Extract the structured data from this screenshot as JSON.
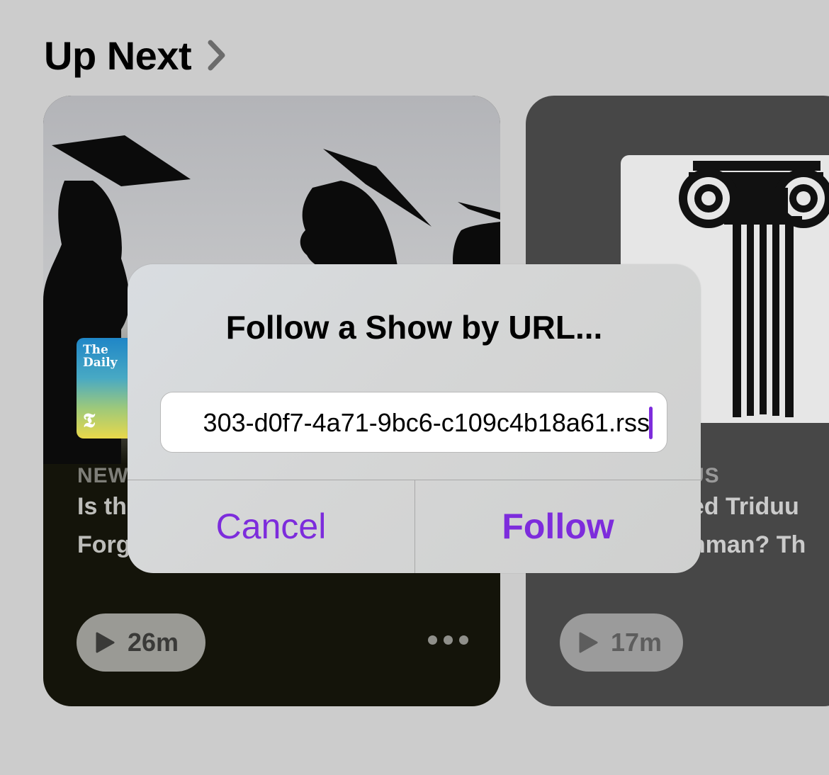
{
  "header": {
    "title": "Up Next"
  },
  "cards": [
    {
      "show_art_text": "The\nDaily",
      "show_art_mark": "𝕿",
      "category": "NEW",
      "title_lines": "Is th\nForg",
      "duration": "26m"
    },
    {
      "category": "US",
      "title_lines": "ssed Triduu\neshman? Th",
      "duration": "17m"
    }
  ],
  "dialog": {
    "title": "Follow a Show by URL...",
    "url_value": "303-d0f7-4a71-9bc6-c109c4b18a61.rss",
    "cancel_label": "Cancel",
    "follow_label": "Follow"
  },
  "colors": {
    "accent": "#7d2cdc",
    "background": "#cccccc",
    "card_dark": "#14140a",
    "card_gray": "#474747"
  }
}
